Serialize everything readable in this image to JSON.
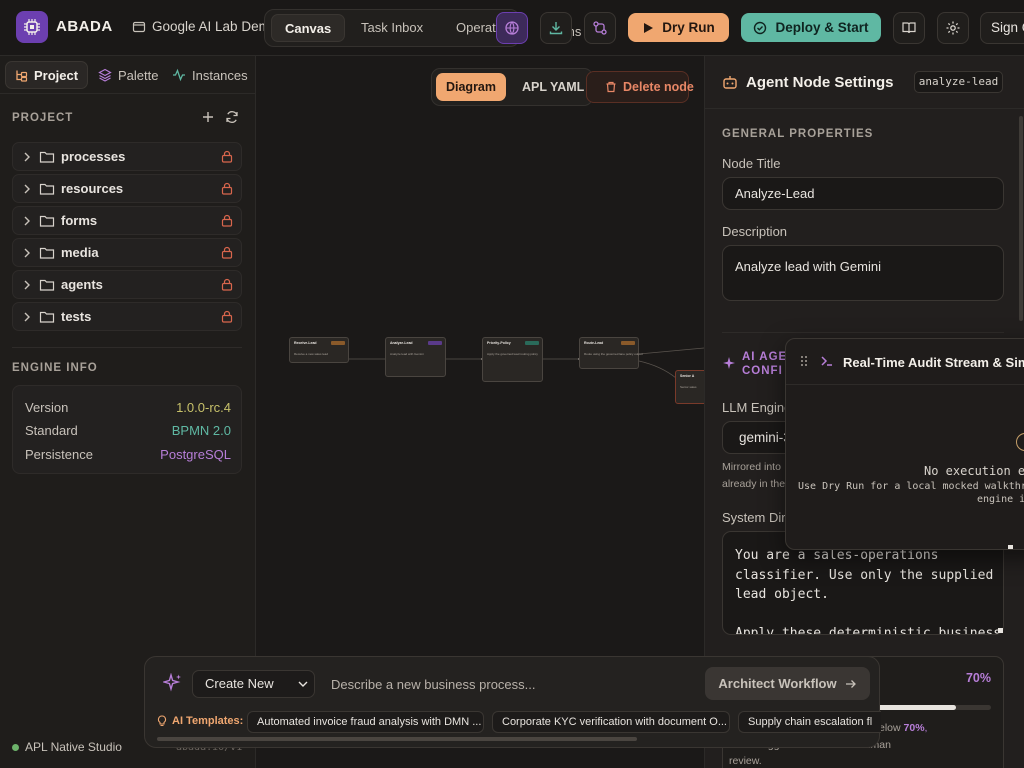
{
  "app": {
    "brand": "ABADA",
    "project_name": "Google AI Lab Demo"
  },
  "header": {
    "tabs": [
      {
        "label": "Canvas",
        "active": true
      },
      {
        "label": "Task Inbox",
        "active": false
      },
      {
        "label": "Operations",
        "active": false
      },
      {
        "label": "Ins",
        "active": false
      }
    ],
    "dry_run_label": "Dry Run",
    "deploy_label": "Deploy & Start",
    "sign_label": "Sign C"
  },
  "sidebar": {
    "tabs": [
      {
        "label": "Project",
        "active": true
      },
      {
        "label": "Palette",
        "active": false
      },
      {
        "label": "Instances",
        "active": false
      }
    ],
    "project_label": "PROJECT",
    "folders": [
      "processes",
      "resources",
      "forms",
      "media",
      "agents",
      "tests"
    ],
    "engine_label": "ENGINE INFO",
    "engine": [
      {
        "key": "Version",
        "value": "1.0.0-rc.4",
        "color": "#c7c16a"
      },
      {
        "key": "Standard",
        "value": "BPMN 2.0",
        "color": "#5fb8a3"
      },
      {
        "key": "Persistence",
        "value": "PostgreSQL",
        "color": "#b77ed8"
      }
    ],
    "footer": "APL Native Studio",
    "footer_path": "abada.io/v1"
  },
  "canvas": {
    "view_tabs": [
      "Diagram",
      "APL YAML"
    ],
    "delete_label": "Delete node",
    "nodes": [
      {
        "title": "Receive-Lead",
        "desc": "Receive a new sales lead"
      },
      {
        "title": "Analyze-Lead",
        "desc": "Analyze lead with Gemini"
      },
      {
        "title": "Priority-Policy",
        "desc": "Apply the governed lead routing policy"
      },
      {
        "title": "Route-Lead",
        "desc": "Route using the governed lane policy output"
      },
      {
        "title": "Senior A",
        "desc": "Senior sales"
      }
    ]
  },
  "composer": {
    "mode": "Create New",
    "placeholder": "Describe a new business process...",
    "architect_label": "Architect Workflow",
    "templates_label": "AI Templates:",
    "templates": [
      "Automated invoice fraud analysis with DMN ...",
      "Corporate KYC verification with document O...",
      "Supply chain escalation fl"
    ]
  },
  "panel": {
    "title": "Agent Node Settings",
    "tag": "analyze-lead",
    "general_label": "GENERAL PROPERTIES",
    "node_title_label": "Node Title",
    "node_title": "Analyze-Lead",
    "description_label": "Description",
    "description": "Analyze lead with Gemini",
    "ai_label_1": "AI AGEN",
    "ai_label_2": "CONFI",
    "llm_label": "LLM Engine",
    "llm_value": "gemini-3",
    "note_1": "Mirrored into",
    "note_2": "already in the",
    "sysdir_label": "System Dire",
    "system_lines": [
      "You are a sales-operations",
      "classifier. Use only the supplied",
      "lead object.",
      "",
      "Apply these deterministic business"
    ],
    "threshold": "70%",
    "threshold_value": 70,
    "threshold_note_1": "s below",
    "threshold_note_value": "70%",
    "threshold_note_2": "triggers escalation to human",
    "threshold_note_3": "review."
  },
  "audit": {
    "title": "Real-Time Audit Stream & Sim",
    "empty": "No execution e",
    "hint_1": "Use Dry Run for a local mocked walkthr",
    "hint_2": "engine i"
  }
}
